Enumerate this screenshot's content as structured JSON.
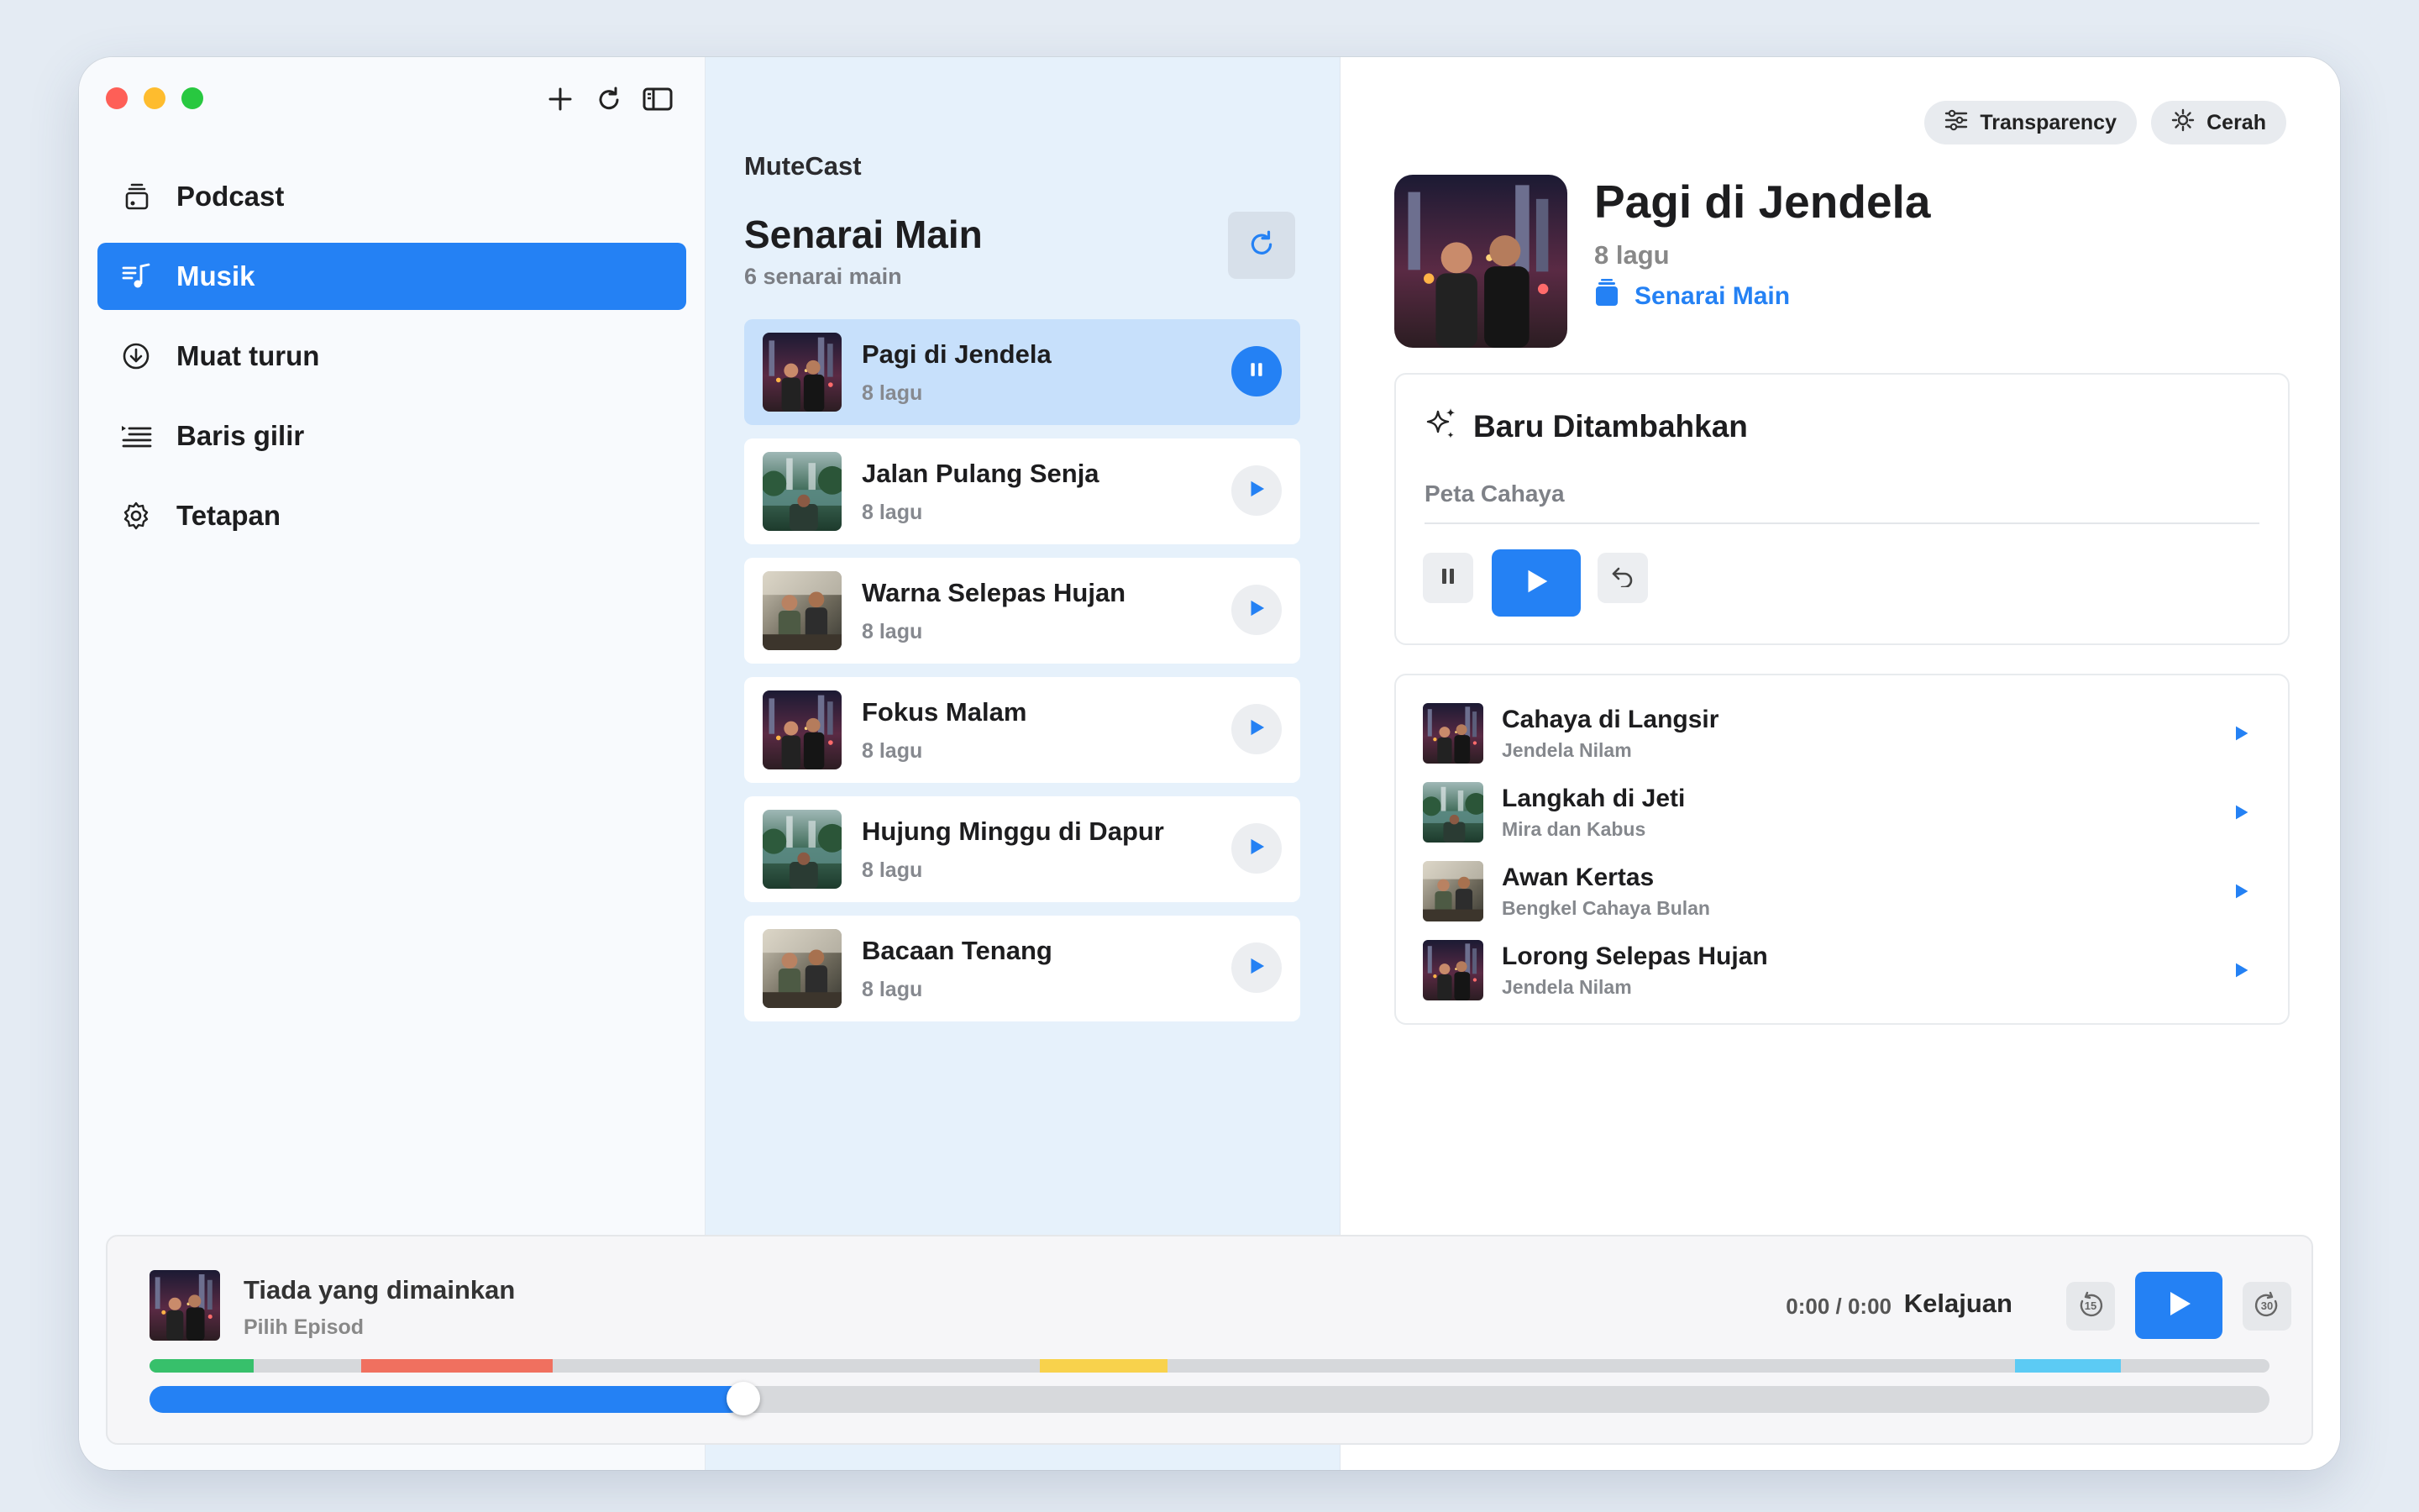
{
  "app": {
    "name": "MuteCast"
  },
  "sidebar": {
    "items": [
      {
        "label": "Podcast",
        "icon": "podcast-stack-icon",
        "active": false
      },
      {
        "label": "Musik",
        "icon": "music-note-list-icon",
        "active": true
      },
      {
        "label": "Muat turun",
        "icon": "download-circle-icon",
        "active": false
      },
      {
        "label": "Baris gilir",
        "icon": "queue-list-icon",
        "active": false
      },
      {
        "label": "Tetapan",
        "icon": "gear-icon",
        "active": false
      }
    ]
  },
  "playlists": {
    "title": "Senarai Main",
    "subtitle": "6 senarai main",
    "items": [
      {
        "name": "Pagi di Jendela",
        "count": "8 lagu",
        "state": "playing"
      },
      {
        "name": "Jalan Pulang Senja",
        "count": "8 lagu",
        "state": "paused"
      },
      {
        "name": "Warna Selepas Hujan",
        "count": "8 lagu",
        "state": "paused"
      },
      {
        "name": "Fokus Malam",
        "count": "8 lagu",
        "state": "paused"
      },
      {
        "name": "Hujung Minggu di Dapur",
        "count": "8 lagu",
        "state": "paused"
      },
      {
        "name": "Bacaan Tenang",
        "count": "8 lagu",
        "state": "paused"
      }
    ]
  },
  "detail": {
    "transparency_label": "Transparency",
    "theme_label": "Cerah",
    "title": "Pagi di Jendela",
    "count": "8 lagu",
    "link_label": "Senarai Main",
    "recent": {
      "title": "Baru Ditambahkan",
      "subtitle": "Peta Cahaya"
    },
    "tracks": [
      {
        "title": "Cahaya di Langsir",
        "artist": "Jendela Nilam"
      },
      {
        "title": "Langkah di Jeti",
        "artist": "Mira dan Kabus"
      },
      {
        "title": "Awan Kertas",
        "artist": "Bengkel Cahaya Bulan"
      },
      {
        "title": "Lorong Selepas Hujan",
        "artist": "Jendela Nilam"
      }
    ]
  },
  "player": {
    "title": "Tiada yang dimainkan",
    "subtitle": "Pilih Episod",
    "time": "0:00 / 0:00",
    "speed_label": "Kelajuan",
    "skip_back": "15",
    "skip_forward": "30",
    "progress": 0.28
  },
  "colors": {
    "accent": "#2481f4",
    "chapter_green": "#37c06b",
    "chapter_red": "#f0705f",
    "chapter_yellow": "#f8d24c",
    "chapter_cyan": "#5ccbf4"
  }
}
